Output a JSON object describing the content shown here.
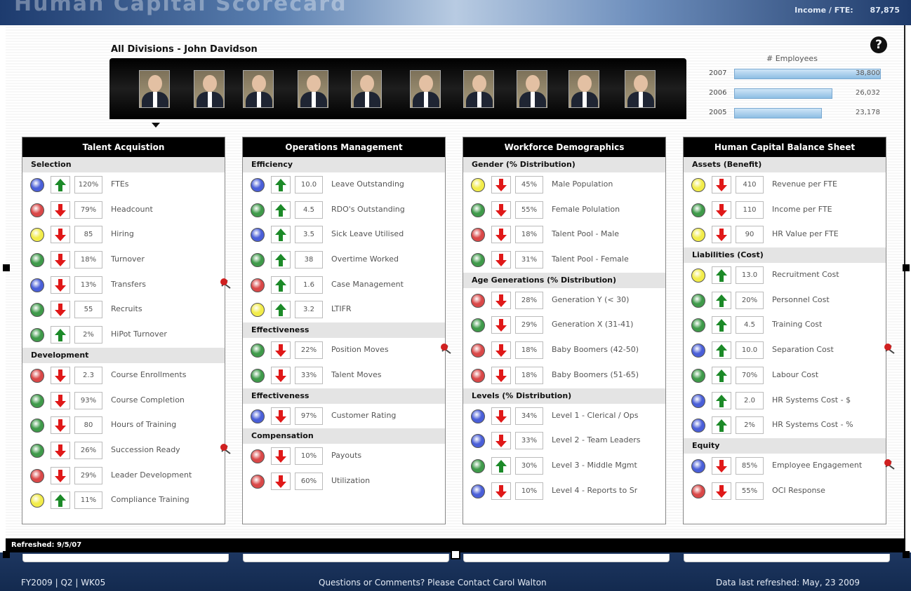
{
  "banner": {
    "title": "Human Capital Scorecard",
    "stat_label": "Income / FTE:",
    "stat_value": "87,875"
  },
  "header": {
    "division_title": "All Divisions - John Davidson"
  },
  "photos": [
    "exec-1",
    "exec-2",
    "exec-3",
    "exec-4",
    "exec-5",
    "exec-6",
    "exec-7",
    "exec-8",
    "exec-9",
    "exec-10"
  ],
  "employees": {
    "title": "# Employees",
    "rows": [
      {
        "year": "2007",
        "value": "38,800",
        "count": 38800
      },
      {
        "year": "2006",
        "value": "26,032",
        "count": 26032
      },
      {
        "year": "2005",
        "value": "23,178",
        "count": 23178
      }
    ]
  },
  "colors": {
    "blue": "#4a5fd8",
    "red": "#d94848",
    "yellow": "#f2ec4a",
    "green": "#3f9a4a",
    "up": "#1c8a28",
    "down": "#e01818"
  },
  "panels": [
    {
      "title": "Talent Acquistion",
      "sections": [
        {
          "name": "Selection",
          "rows": [
            {
              "status": "blue",
              "trend": "up",
              "value": "120%",
              "label": "FTEs"
            },
            {
              "status": "red",
              "trend": "down",
              "value": "79%",
              "label": "Headcount"
            },
            {
              "status": "yellow",
              "trend": "down",
              "value": "85",
              "label": "Hiring"
            },
            {
              "status": "green",
              "trend": "down",
              "value": "18%",
              "label": "Turnover"
            },
            {
              "status": "blue",
              "trend": "down",
              "value": "13%",
              "label": "Transfers",
              "pin": true
            },
            {
              "status": "green",
              "trend": "down",
              "value": "55",
              "label": "Recruits"
            },
            {
              "status": "green",
              "trend": "up",
              "value": "2%",
              "label": "HiPot Turnover"
            }
          ]
        },
        {
          "name": "Development",
          "rows": [
            {
              "status": "red",
              "trend": "down",
              "value": "2.3",
              "label": "Course Enrollments"
            },
            {
              "status": "green",
              "trend": "down",
              "value": "93%",
              "label": "Course Completion"
            },
            {
              "status": "green",
              "trend": "down",
              "value": "80",
              "label": "Hours of Training"
            },
            {
              "status": "green",
              "trend": "down",
              "value": "26%",
              "label": "Succession Ready",
              "pin": true
            },
            {
              "status": "red",
              "trend": "down",
              "value": "29%",
              "label": "Leader Development"
            },
            {
              "status": "yellow",
              "trend": "up",
              "value": "11%",
              "label": "Compliance Training"
            }
          ]
        }
      ]
    },
    {
      "title": "Operations Management",
      "sections": [
        {
          "name": "Efficiency",
          "rows": [
            {
              "status": "blue",
              "trend": "up",
              "value": "10.0",
              "label": "Leave Outstanding"
            },
            {
              "status": "green",
              "trend": "up",
              "value": "4.5",
              "label": "RDO's Outstanding"
            },
            {
              "status": "blue",
              "trend": "up",
              "value": "3.5",
              "label": "Sick Leave Utilised"
            },
            {
              "status": "green",
              "trend": "up",
              "value": "38",
              "label": "Overtime Worked"
            },
            {
              "status": "red",
              "trend": "up",
              "value": "1.6",
              "label": "Case Management"
            },
            {
              "status": "yellow",
              "trend": "up",
              "value": "3.2",
              "label": "LTIFR"
            }
          ]
        },
        {
          "name": "Effectiveness",
          "rows": [
            {
              "status": "green",
              "trend": "down",
              "value": "22%",
              "label": "Position Moves",
              "pin": true
            },
            {
              "status": "green",
              "trend": "down",
              "value": "33%",
              "label": "Talent Moves"
            }
          ]
        },
        {
          "name": "Effectiveness",
          "rows": [
            {
              "status": "blue",
              "trend": "down",
              "value": "97%",
              "label": "Customer Rating"
            }
          ]
        },
        {
          "name": "Compensation",
          "rows": [
            {
              "status": "red",
              "trend": "down",
              "value": "10%",
              "label": "Payouts"
            },
            {
              "status": "red",
              "trend": "down",
              "value": "60%",
              "label": "Utilization"
            }
          ]
        }
      ]
    },
    {
      "title": "Workforce Demographics",
      "sections": [
        {
          "name": "Gender (% Distribution)",
          "rows": [
            {
              "status": "yellow",
              "trend": "down",
              "value": "45%",
              "label": "Male Population"
            },
            {
              "status": "green",
              "trend": "down",
              "value": "55%",
              "label": "Female Polulation"
            },
            {
              "status": "red",
              "trend": "down",
              "value": "18%",
              "label": "Talent Pool - Male"
            },
            {
              "status": "green",
              "trend": "down",
              "value": "31%",
              "label": "Talent Pool - Female"
            }
          ]
        },
        {
          "name": "Age Generations (% Distribution)",
          "rows": [
            {
              "status": "red",
              "trend": "down",
              "value": "28%",
              "label": "Generation Y (< 30)"
            },
            {
              "status": "green",
              "trend": "down",
              "value": "29%",
              "label": "Generation X (31-41)"
            },
            {
              "status": "red",
              "trend": "down",
              "value": "18%",
              "label": "Baby Boomers (42-50)"
            },
            {
              "status": "red",
              "trend": "down",
              "value": "18%",
              "label": "Baby Boomers (51-65)"
            }
          ]
        },
        {
          "name": "Levels (% Distribution)",
          "rows": [
            {
              "status": "blue",
              "trend": "down",
              "value": "34%",
              "label": "Level 1 - Clerical / Ops"
            },
            {
              "status": "blue",
              "trend": "down",
              "value": "33%",
              "label": "Level 2 - Team Leaders"
            },
            {
              "status": "green",
              "trend": "up",
              "value": "30%",
              "label": "Level 3 - Middle Mgmt"
            },
            {
              "status": "blue",
              "trend": "down",
              "value": "10%",
              "label": "Level 4 - Reports to Sr"
            }
          ]
        }
      ]
    },
    {
      "title": "Human Capital Balance Sheet",
      "sections": [
        {
          "name": "Assets (Benefit)",
          "rows": [
            {
              "status": "yellow",
              "trend": "down",
              "value": "410",
              "label": "Revenue per FTE"
            },
            {
              "status": "green",
              "trend": "down",
              "value": "110",
              "label": "Income per FTE"
            },
            {
              "status": "yellow",
              "trend": "down",
              "value": "90",
              "label": "HR Value per FTE"
            }
          ]
        },
        {
          "name": "Liabilities (Cost)",
          "rows": [
            {
              "status": "yellow",
              "trend": "up",
              "value": "13.0",
              "label": "Recruitment Cost"
            },
            {
              "status": "green",
              "trend": "up",
              "value": "20%",
              "label": "Personnel Cost"
            },
            {
              "status": "green",
              "trend": "up",
              "value": "4.5",
              "label": "Training Cost"
            },
            {
              "status": "blue",
              "trend": "up",
              "value": "10.0",
              "label": "Separation Cost",
              "pin": true
            },
            {
              "status": "green",
              "trend": "up",
              "value": "70%",
              "label": "Labour Cost"
            },
            {
              "status": "blue",
              "trend": "up",
              "value": "2.0",
              "label": "HR Systems Cost - $"
            },
            {
              "status": "blue",
              "trend": "up",
              "value": "2%",
              "label": "HR Systems Cost - %"
            }
          ]
        },
        {
          "name": "Equity",
          "rows": [
            {
              "status": "blue",
              "trend": "down",
              "value": "85%",
              "label": "Employee Engagement",
              "pin": true
            },
            {
              "status": "red",
              "trend": "down",
              "value": "55%",
              "label": "OCI Response"
            }
          ]
        }
      ]
    }
  ],
  "footer": {
    "refreshed": "Refreshed: 9/5/07",
    "period": "FY2009 | Q2 | WK05",
    "contact": "Questions or Comments?  Please Contact Carol Walton",
    "last_refreshed": "Data last refreshed:  May, 23 2009"
  }
}
